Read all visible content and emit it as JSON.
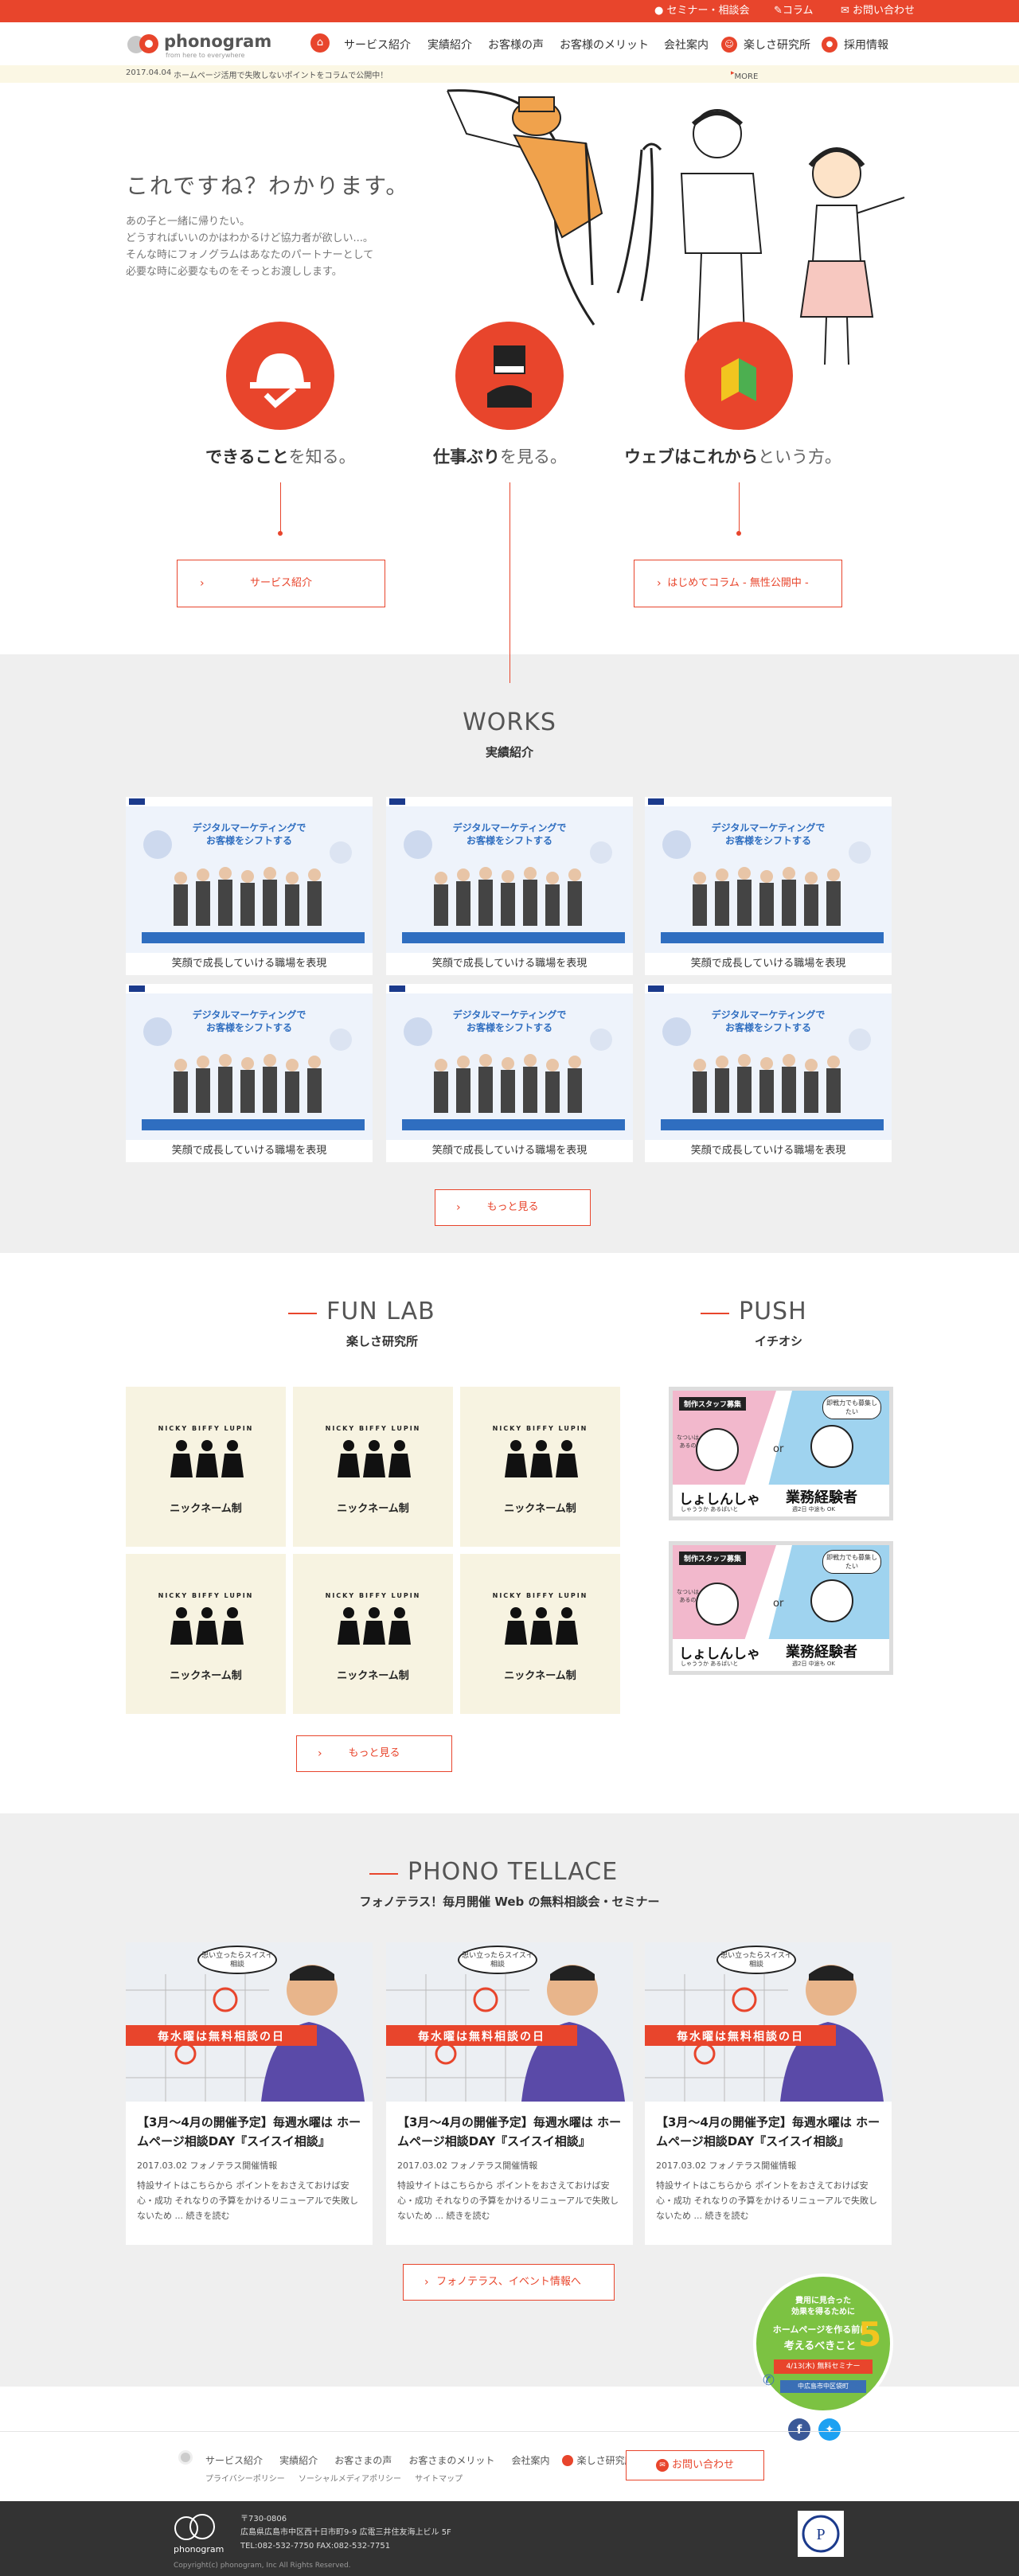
{
  "topbar": {
    "links": [
      "セミナー・相談会",
      "コラム",
      "お問い合わせ"
    ]
  },
  "header": {
    "logo_text": "phonogram",
    "logo_tagline": "from here to everywhere",
    "nav": [
      "サービス紹介",
      "実績紹介",
      "お客様の声",
      "お客様のメリット",
      "会社案内",
      "楽しさ研究所",
      "採用情報"
    ]
  },
  "ticker": {
    "date": "2017.04.04",
    "text": "ホームページ活用で失敗しないポイントをコラムで公開中！",
    "more": "MORE"
  },
  "hero": {
    "title": "これですね？わかります。",
    "lines": [
      "あの子と一緒に帰りたい。",
      "どうすればいいのかはわかるけど協力者が欲しい...。",
      "そんな時にフォノグラムはあなたのパートナーとして",
      "必要な時に必要なものをそっとお渡しします。"
    ]
  },
  "features": [
    {
      "bold": "できること",
      "thin": "を知る。"
    },
    {
      "bold": "仕事ぶり",
      "thin": "を見る。"
    },
    {
      "bold": "ウェブはこれから",
      "thin": "という方。"
    }
  ],
  "feature_buttons": [
    "サービス紹介",
    "はじめてコラム - 無性公開中 -"
  ],
  "works": {
    "title": "WORKS",
    "subtitle": "実績紹介",
    "banner_line1": "デジタルマーケティングで",
    "banner_line2": "お客様をシフトする",
    "items": [
      "笑顔で成長していける職場を表現",
      "笑顔で成長していける職場を表現",
      "笑顔で成長していける職場を表現",
      "笑顔で成長していける職場を表現",
      "笑顔で成長していける職場を表現",
      "笑顔で成長していける職場を表現"
    ],
    "more": "もっと見る"
  },
  "funlab": {
    "title": "FUN LAB",
    "subtitle": "楽しさ研究所",
    "names": "NICKY BIFFY LUPIN",
    "items": [
      "ニックネーム制",
      "ニックネーム制",
      "ニックネーム制",
      "ニックネーム制",
      "ニックネーム制",
      "ニックネーム制"
    ],
    "more": "もっと見る"
  },
  "push": {
    "title": "PUSH",
    "subtitle": "イチオシ",
    "items": [
      {
        "badge": "制作スタッフ募集",
        "left": "しょしんしゃ",
        "left_sub": "しゃううか あるばいと",
        "right": "業務経験者",
        "right_sub": "週2日 中途も OK",
        "or": "or",
        "bubble": "即戦力でも募集したい",
        "bubble2": "なついはあるの"
      },
      {
        "badge": "制作スタッフ募集",
        "left": "しょしんしゃ",
        "left_sub": "しゃううか あるばいと",
        "right": "業務経験者",
        "right_sub": "週2日 中途も OK",
        "or": "or",
        "bubble": "即戦力でも募集したい",
        "bubble2": "なついはあるの"
      }
    ]
  },
  "tellace": {
    "title": "PHONO TELLACE",
    "subtitle": "フォノテラス！毎月開催 Web の無料相談会・セミナー",
    "banner": "毎水曜は無料相談の日",
    "bubble": "思い立ったらスイスイ相談",
    "items": [
      {
        "title": "【3月〜4月の開催予定】毎週水曜は ホームページ相談DAY『スイスイ相談』",
        "date": "2017.03.02",
        "category": "フォノテラス開催情報",
        "text": "特設サイトはこちらから ポイントをおさえておけば安心・成功 それなりの予算をかけるリニューアルで失敗しないため ... 続きを読む"
      },
      {
        "title": "【3月〜4月の開催予定】毎週水曜は ホームページ相談DAY『スイスイ相談』",
        "date": "2017.03.02",
        "category": "フォノテラス開催情報",
        "text": "特設サイトはこちらから ポイントをおさえておけば安心・成功 それなりの予算をかけるリニューアルで失敗しないため ... 続きを読む"
      },
      {
        "title": "【3月〜4月の開催予定】毎週水曜は ホームページ相談DAY『スイスイ相談』",
        "date": "2017.03.02",
        "category": "フォノテラス開催情報",
        "text": "特設サイトはこちらから ポイントをおさえておけば安心・成功 それなりの予算をかけるリニューアルで失敗しないため ... 続きを読む"
      }
    ],
    "more": "フォノテラス、イベント情報へ"
  },
  "promo": {
    "line1": "費用に見合った",
    "line2": "効果を得るために",
    "line3": "ホームページを作る前に",
    "line4": "考えるべきこと",
    "num": "5",
    "date": "4/13(木) 無料セミナー",
    "venue": "中広島市中区袋町"
  },
  "footer": {
    "nav": [
      "サービス紹介",
      "実績紹介",
      "お客さまの声",
      "お客さまのメリット",
      "会社案内",
      "楽しさ研究所"
    ],
    "sub": [
      "プライバシーポリシー",
      "ソーシャルメディアポリシー",
      "サイトマップ"
    ],
    "contact": "お問い合わせ",
    "zip": "〒730-0806",
    "address": "広島県広島市中区西十日市町9-9 広電三井住友海上ビル 5F",
    "tel": "TEL:082-532-7750 FAX:082-532-7751",
    "copyright": "Copyright(c) phonogram, Inc All Rights Reserved."
  },
  "colors": {
    "accent": "#e8452c",
    "gray_bg": "#efefef",
    "dark": "#333333",
    "lab_bg": "#f7f3e1"
  }
}
